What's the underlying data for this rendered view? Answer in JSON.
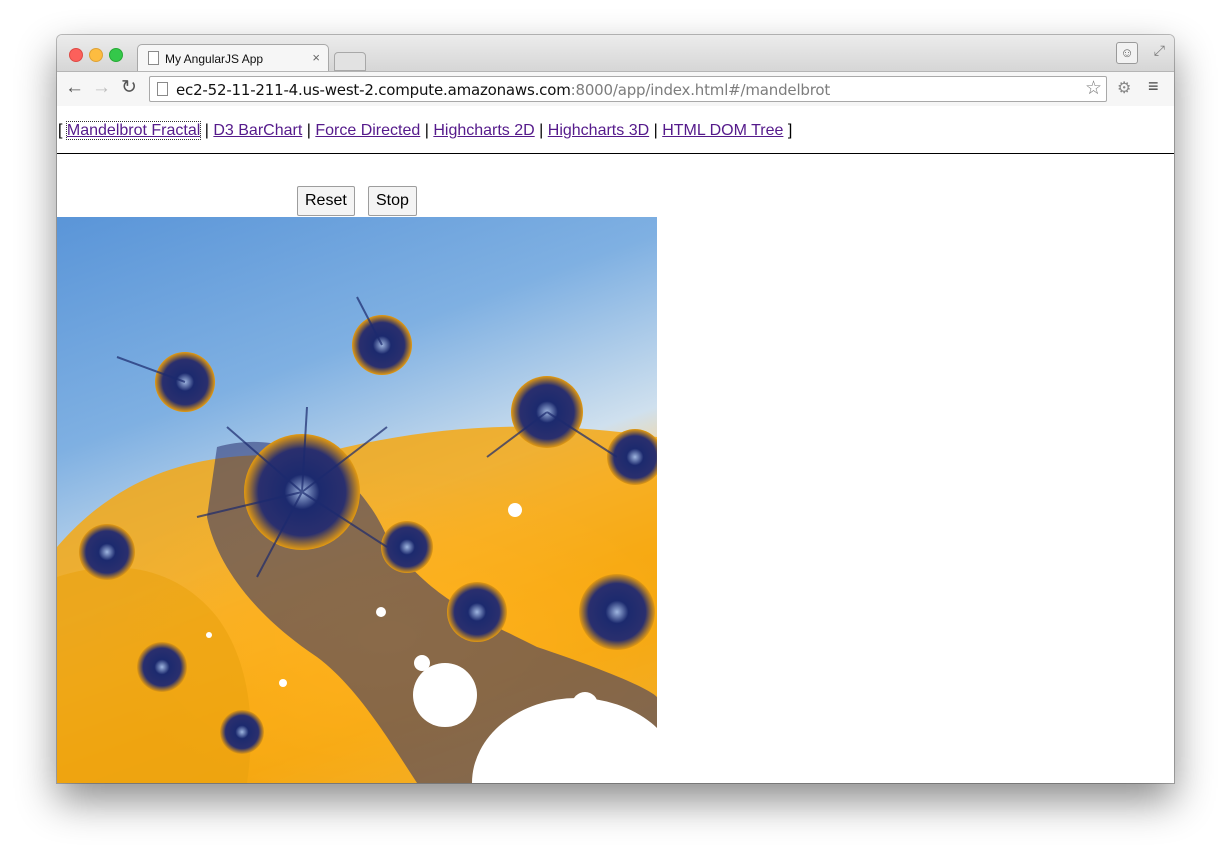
{
  "browser": {
    "tab_title": "My AngularJS App",
    "tab_close": "×",
    "url_host": "ec2-52-11-211-4.us-west-2.compute.amazonaws.com",
    "url_rest": ":8000/app/index.html#/mandelbrot"
  },
  "icons": {
    "back": "arrow-left",
    "forward": "arrow-right",
    "reload": "reload",
    "bookmark": "star",
    "extension": "extension",
    "menu": "hamburger",
    "profile": "person",
    "fullscreen": "expand"
  },
  "nav": {
    "open_bracket": "[",
    "close_bracket": "]",
    "separator": "|",
    "links": [
      "Mandelbrot Fractal",
      "D3 BarChart",
      "Force Directed",
      "Highcharts 2D",
      "Highcharts 3D",
      "HTML DOM Tree"
    ],
    "active_index": 0
  },
  "controls": {
    "reset_label": "Reset",
    "stop_label": "Stop"
  },
  "colors": {
    "link": "#551a8b",
    "fractal_orange": "#ffb21f",
    "fractal_blue": "#5a95d8",
    "fractal_dark": "#1c2a6e"
  }
}
